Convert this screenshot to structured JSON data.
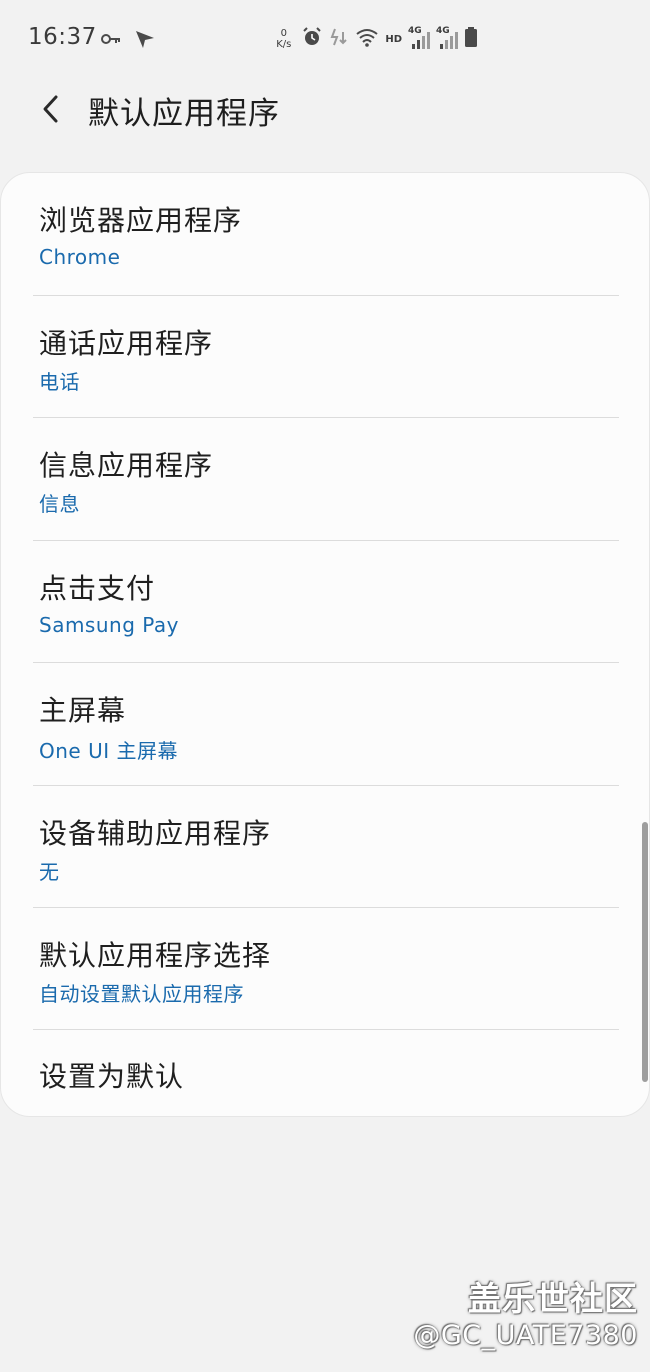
{
  "status_bar": {
    "time": "16:37",
    "net_speed_value": "0",
    "net_speed_unit": "K/s",
    "hd": "HD",
    "sim1": "4G",
    "sim2": "4G",
    "icons": [
      "key-icon",
      "send-icon",
      "alarm-icon",
      "data-arrows-icon",
      "wifi-icon",
      "signal-icon",
      "battery-icon"
    ]
  },
  "header": {
    "title": "默认应用程序"
  },
  "settings": {
    "items": [
      {
        "title": "浏览器应用程序",
        "value": "Chrome"
      },
      {
        "title": "通话应用程序",
        "value": "电话"
      },
      {
        "title": "信息应用程序",
        "value": "信息"
      },
      {
        "title": "点击支付",
        "value": "Samsung Pay"
      },
      {
        "title": "主屏幕",
        "value": "One UI 主屏幕"
      },
      {
        "title": "设备辅助应用程序",
        "value": "无"
      },
      {
        "title": "默认应用程序选择",
        "value": "自动设置默认应用程序"
      },
      {
        "title": "设置为默认"
      }
    ]
  },
  "watermark": {
    "line1": "盖乐世社区",
    "line2": "@GC_UATE7380"
  },
  "colors": {
    "background": "#f2f2f2",
    "card": "#fcfcfc",
    "accent": "#1a6aad",
    "text": "#1f1f1f"
  }
}
